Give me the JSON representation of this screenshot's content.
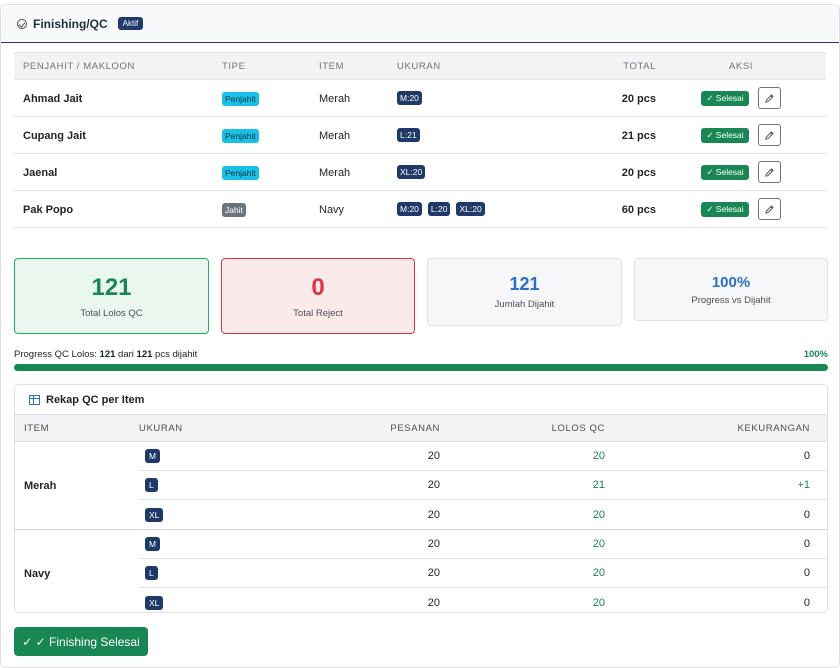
{
  "header": {
    "title": "Finishing/QC",
    "badge": "Aktif"
  },
  "table": {
    "columns": [
      "PENJAHIT / MAKLOON",
      "TIPE",
      "ITEM",
      "UKURAN",
      "TOTAL",
      "AKSI"
    ],
    "rows": [
      {
        "name": "Ahmad Jait",
        "tipe": "Penjahit",
        "item": "Merah",
        "sizes": [
          "M:20"
        ],
        "total": "20 pcs",
        "status": "✓ Selesai"
      },
      {
        "name": "Cupang Jait",
        "tipe": "Penjahit",
        "item": "Merah",
        "sizes": [
          "L:21"
        ],
        "total": "21 pcs",
        "status": "✓ Selesai"
      },
      {
        "name": "Jaenal",
        "tipe": "Penjahit",
        "item": "Merah",
        "sizes": [
          "XL:20"
        ],
        "total": "20 pcs",
        "status": "✓ Selesai"
      },
      {
        "name": "Pak Popo",
        "tipe": "Jahit",
        "item": "Navy",
        "sizes": [
          "M:20",
          "L:20",
          "XL:20"
        ],
        "total": "60 pcs",
        "status": "✓ Selesai"
      }
    ]
  },
  "stats": {
    "lolos": {
      "value": "121",
      "label": "Total Lolos QC"
    },
    "reject": {
      "value": "0",
      "label": "Total Reject"
    },
    "dijahit": {
      "value": "121",
      "label": "Jumlah Dijahit"
    },
    "progress": {
      "value": "100%",
      "label": "Progress vs Dijahit"
    }
  },
  "progress": {
    "prefix": "Progress QC Lolos: ",
    "lolos": "121",
    "middle": " dari ",
    "total": "121",
    "suffix": " pcs dijahit",
    "percent_label": "100%",
    "fraction": 1.0
  },
  "rekap": {
    "title": "Rekap QC per Item",
    "columns": [
      "ITEM",
      "UKURAN",
      "PESANAN",
      "LOLOS QC",
      "KEKURANGAN"
    ],
    "groups": [
      {
        "item": "Merah",
        "rows": [
          {
            "size": "M",
            "pesanan": "20",
            "lolos": "20",
            "kurang": "0"
          },
          {
            "size": "L",
            "pesanan": "20",
            "lolos": "21",
            "kurang": "+1"
          },
          {
            "size": "XL",
            "pesanan": "20",
            "lolos": "20",
            "kurang": "0"
          }
        ]
      },
      {
        "item": "Navy",
        "rows": [
          {
            "size": "M",
            "pesanan": "20",
            "lolos": "20",
            "kurang": "0"
          },
          {
            "size": "L",
            "pesanan": "20",
            "lolos": "20",
            "kurang": "0"
          },
          {
            "size": "XL",
            "pesanan": "20",
            "lolos": "20",
            "kurang": "0"
          }
        ]
      }
    ]
  },
  "footer": {
    "button_label": "✓ ✓ Finishing Selesai"
  },
  "colors": {
    "primary": "#1f3a68",
    "success": "#198754",
    "danger": "#dc3545",
    "info": "#17c1e8",
    "accent_blue": "#2b6fc7"
  }
}
